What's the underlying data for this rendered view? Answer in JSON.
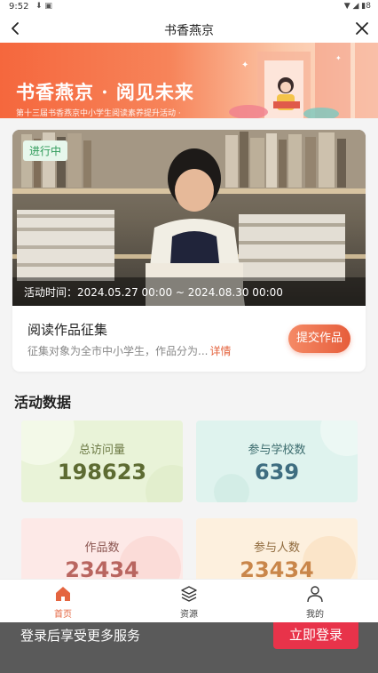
{
  "status_bar": {
    "time": "9:52",
    "battery": "8"
  },
  "nav": {
    "title": "书香燕京"
  },
  "banner": {
    "title": "书香燕京 · 阅见未来",
    "subtitle": "第十三届书香燕京中小学生阅读素养提升活动 ·"
  },
  "activity": {
    "status": "进行中",
    "time_text": "活动时间：2024.05.27 00:00 ~ 2024.08.30 00:00",
    "title": "阅读作品征集",
    "desc": "征集对象为全市中小学生，作品分为...",
    "more": "详情",
    "submit": "提交作品"
  },
  "stats_section": {
    "title": "活动数据",
    "items": [
      {
        "label": "总访问量",
        "value": "198623"
      },
      {
        "label": "参与学校数",
        "value": "639"
      },
      {
        "label": "作品数",
        "value": "23434"
      },
      {
        "label": "参与人数",
        "value": "23434"
      }
    ]
  },
  "tabs": [
    {
      "label": "首页",
      "icon": "home-icon",
      "active": true
    },
    {
      "label": "资源",
      "icon": "layers-icon",
      "active": false
    },
    {
      "label": "我的",
      "icon": "user-icon",
      "active": false
    }
  ],
  "login": {
    "text": "登录后享受更多服务",
    "button": "立即登录"
  },
  "colors": {
    "accent": "#e4643f",
    "login_button": "#e8334a",
    "status_green": "#2f9b5a"
  }
}
